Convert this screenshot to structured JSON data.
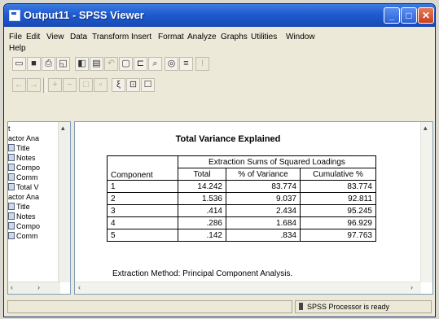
{
  "window": {
    "title": "Output11 - SPSS Viewer"
  },
  "menu": [
    "File",
    "Edit",
    "View",
    "Data",
    "Transform",
    "Insert",
    "Format",
    "Analyze",
    "Graphs",
    "Utilities",
    "Window",
    "Help"
  ],
  "outline": {
    "items": [
      {
        "label": "t",
        "icon": "none"
      },
      {
        "label": "actor Ana",
        "icon": "none"
      },
      {
        "label": "Title",
        "icon": "title-icon"
      },
      {
        "label": "Notes",
        "icon": "notes-icon"
      },
      {
        "label": "Compo",
        "icon": "table-icon"
      },
      {
        "label": "Comm",
        "icon": "table-icon"
      },
      {
        "label": "Total V",
        "icon": "table-icon"
      },
      {
        "label": "actor Ana",
        "icon": "none"
      },
      {
        "label": "Title",
        "icon": "title-icon"
      },
      {
        "label": "Notes",
        "icon": "notes-icon"
      },
      {
        "label": "Compo",
        "icon": "table-icon"
      },
      {
        "label": "Comm",
        "icon": "table-icon"
      }
    ]
  },
  "output_table": {
    "title": "Total Variance Explained",
    "group_header": "Extraction Sums of Squared Loadings",
    "columns": [
      "Component",
      "Total",
      "% of Variance",
      "Cumulative %"
    ],
    "rows": [
      [
        "1",
        "14.242",
        "83.774",
        "83.774"
      ],
      [
        "2",
        "1.536",
        "9.037",
        "92.811"
      ],
      [
        "3",
        ".414",
        "2.434",
        "95.245"
      ],
      [
        "4",
        ".286",
        "1.684",
        "96.929"
      ],
      [
        "5",
        ".142",
        ".834",
        "97.763"
      ]
    ],
    "footnote": "Extraction Method: Principal Component Analysis."
  },
  "status": {
    "processor": "SPSS Processor  is ready"
  }
}
